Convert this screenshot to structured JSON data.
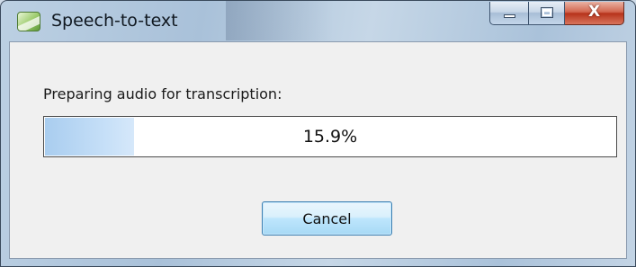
{
  "window": {
    "title": "Speech-to-text",
    "close_glyph": "X"
  },
  "dialog": {
    "prompt": "Preparing audio for transcription:",
    "progress": {
      "value_percent": 15.9,
      "label": "15.9%"
    },
    "cancel_label": "Cancel"
  },
  "icons": {
    "app": "app-icon",
    "minimize": "minimize-icon",
    "maximize": "maximize-icon",
    "close": "close-icon"
  },
  "colors": {
    "progress_fill": "#a9cdef",
    "close_button": "#c43f24"
  }
}
